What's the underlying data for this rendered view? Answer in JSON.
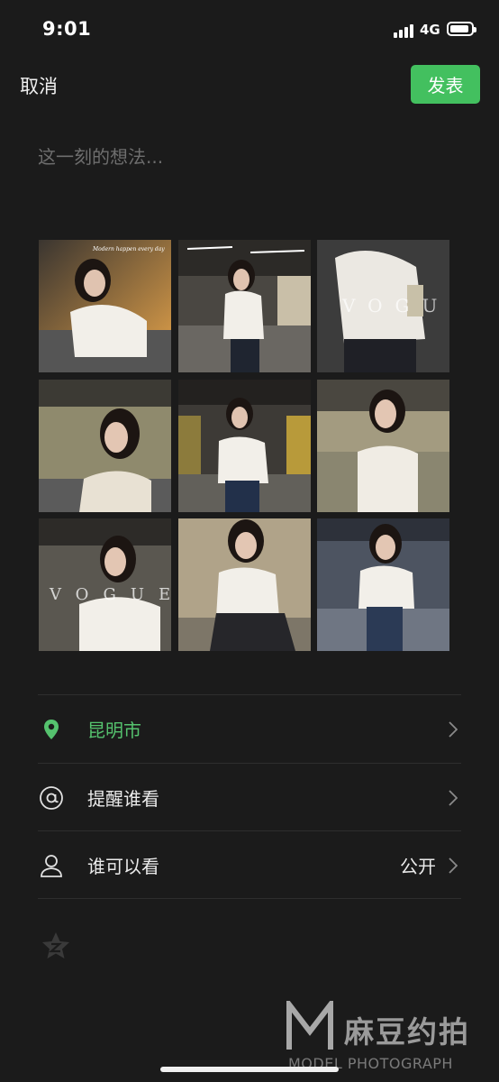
{
  "status_bar": {
    "time": "9:01",
    "network": "4G"
  },
  "nav": {
    "cancel_label": "取消",
    "publish_label": "发表"
  },
  "composer": {
    "placeholder": "这一刻的想法..."
  },
  "photos": [
    {
      "name": "photo-1",
      "caption": "Modern happen every day"
    },
    {
      "name": "photo-2"
    },
    {
      "name": "photo-3",
      "caption": "VOGUE"
    },
    {
      "name": "photo-4"
    },
    {
      "name": "photo-5"
    },
    {
      "name": "photo-6"
    },
    {
      "name": "photo-7",
      "caption": "VOGUE"
    },
    {
      "name": "photo-8"
    },
    {
      "name": "photo-9"
    }
  ],
  "options": {
    "location": {
      "label": "昆明市",
      "icon": "location-pin-icon"
    },
    "mention": {
      "label": "提醒谁看",
      "icon": "at-icon"
    },
    "visibility": {
      "label": "谁可以看",
      "value": "公开",
      "icon": "person-icon"
    }
  },
  "watermark": {
    "brand_cn": "麻豆约拍",
    "brand_en": "MODEL PHOTOGRAPH"
  },
  "colors": {
    "accent": "#43c05f",
    "background": "#1b1b1b",
    "location_green": "#55c26e"
  }
}
